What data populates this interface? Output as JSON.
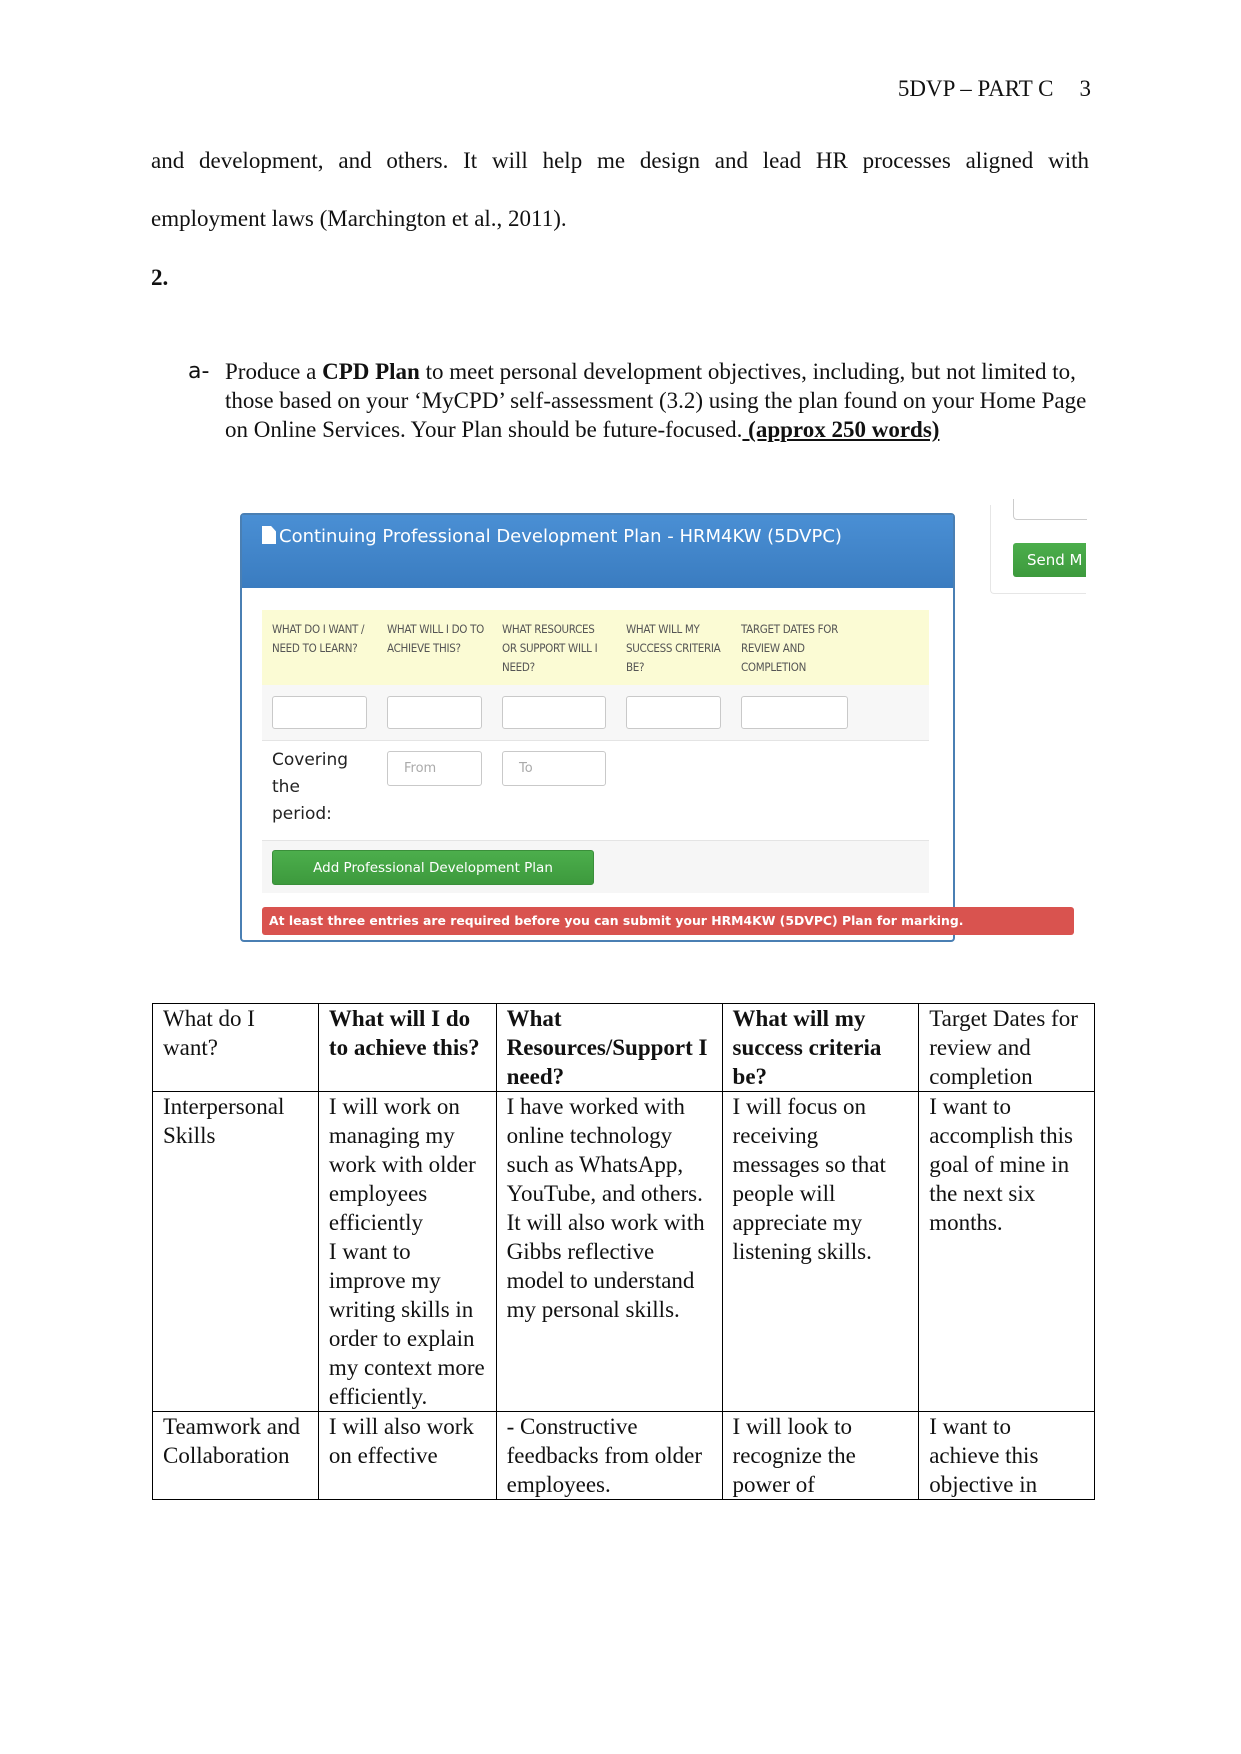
{
  "header": {
    "title": "5DVP – PART C",
    "page_number": "3"
  },
  "body": {
    "paragraph_continued": "and development, and others. It will help me design and lead HR processes aligned with",
    "paragraph_end": "employment laws (Marchington et al., 2011).",
    "section_number": "2.",
    "question": {
      "marker": "a-",
      "text_before": "Produce a ",
      "bold": "CPD Plan",
      "text_after": " to meet personal development objectives, including, but not limited to, those based on your ‘MyCPD’ self-assessment (3.2) using the plan found on your Home Page on Online Services. Your Plan should be future-focused.",
      "underlined": " (approx 250 words) "
    }
  },
  "cpd_widget": {
    "title": "Continuing Professional Development Plan - HRM4KW (5DVPC)",
    "title_icon": "document-icon",
    "columns": [
      "WHAT DO I WANT / NEED TO LEARN?",
      "WHAT WILL I DO TO ACHIEVE THIS?",
      "WHAT RESOURCES OR SUPPORT WILL I NEED?",
      "WHAT WILL MY SUCCESS CRITERIA BE?",
      "TARGET DATES FOR REVIEW AND COMPLETION"
    ],
    "inputs": [
      "",
      "",
      "",
      "",
      ""
    ],
    "period_label": "Covering the period:",
    "from_placeholder": "From",
    "to_placeholder": "To",
    "add_button": "Add Professional Development Plan",
    "alert": "At least three entries are required before you can submit your HRM4KW (5DVPC) Plan for marking.",
    "send_button": "Send M"
  },
  "plan_table": {
    "headers": [
      "What do I want?",
      "What will I do to achieve this?",
      "What Resources/Support I need?",
      "What will my success criteria be?",
      "Target Dates for review and completion"
    ],
    "rows": [
      [
        "Interpersonal Skills",
        "I will work on managing my work with older employees efficiently\nI want to improve my writing skills in order to explain my context more efficiently.",
        "I have worked with online technology such as WhatsApp, YouTube, and others. It will also work with Gibbs reflective model to understand my personal skills.",
        "I will focus on receiving messages so that people will appreciate my listening skills.",
        "I want to accomplish this goal of mine in the next six months."
      ],
      [
        "Teamwork and Collaboration",
        "I will also work on effective",
        "- Constructive feedbacks from older employees.",
        "I will look to recognize the power of",
        "I want to achieve this objective in"
      ]
    ]
  }
}
